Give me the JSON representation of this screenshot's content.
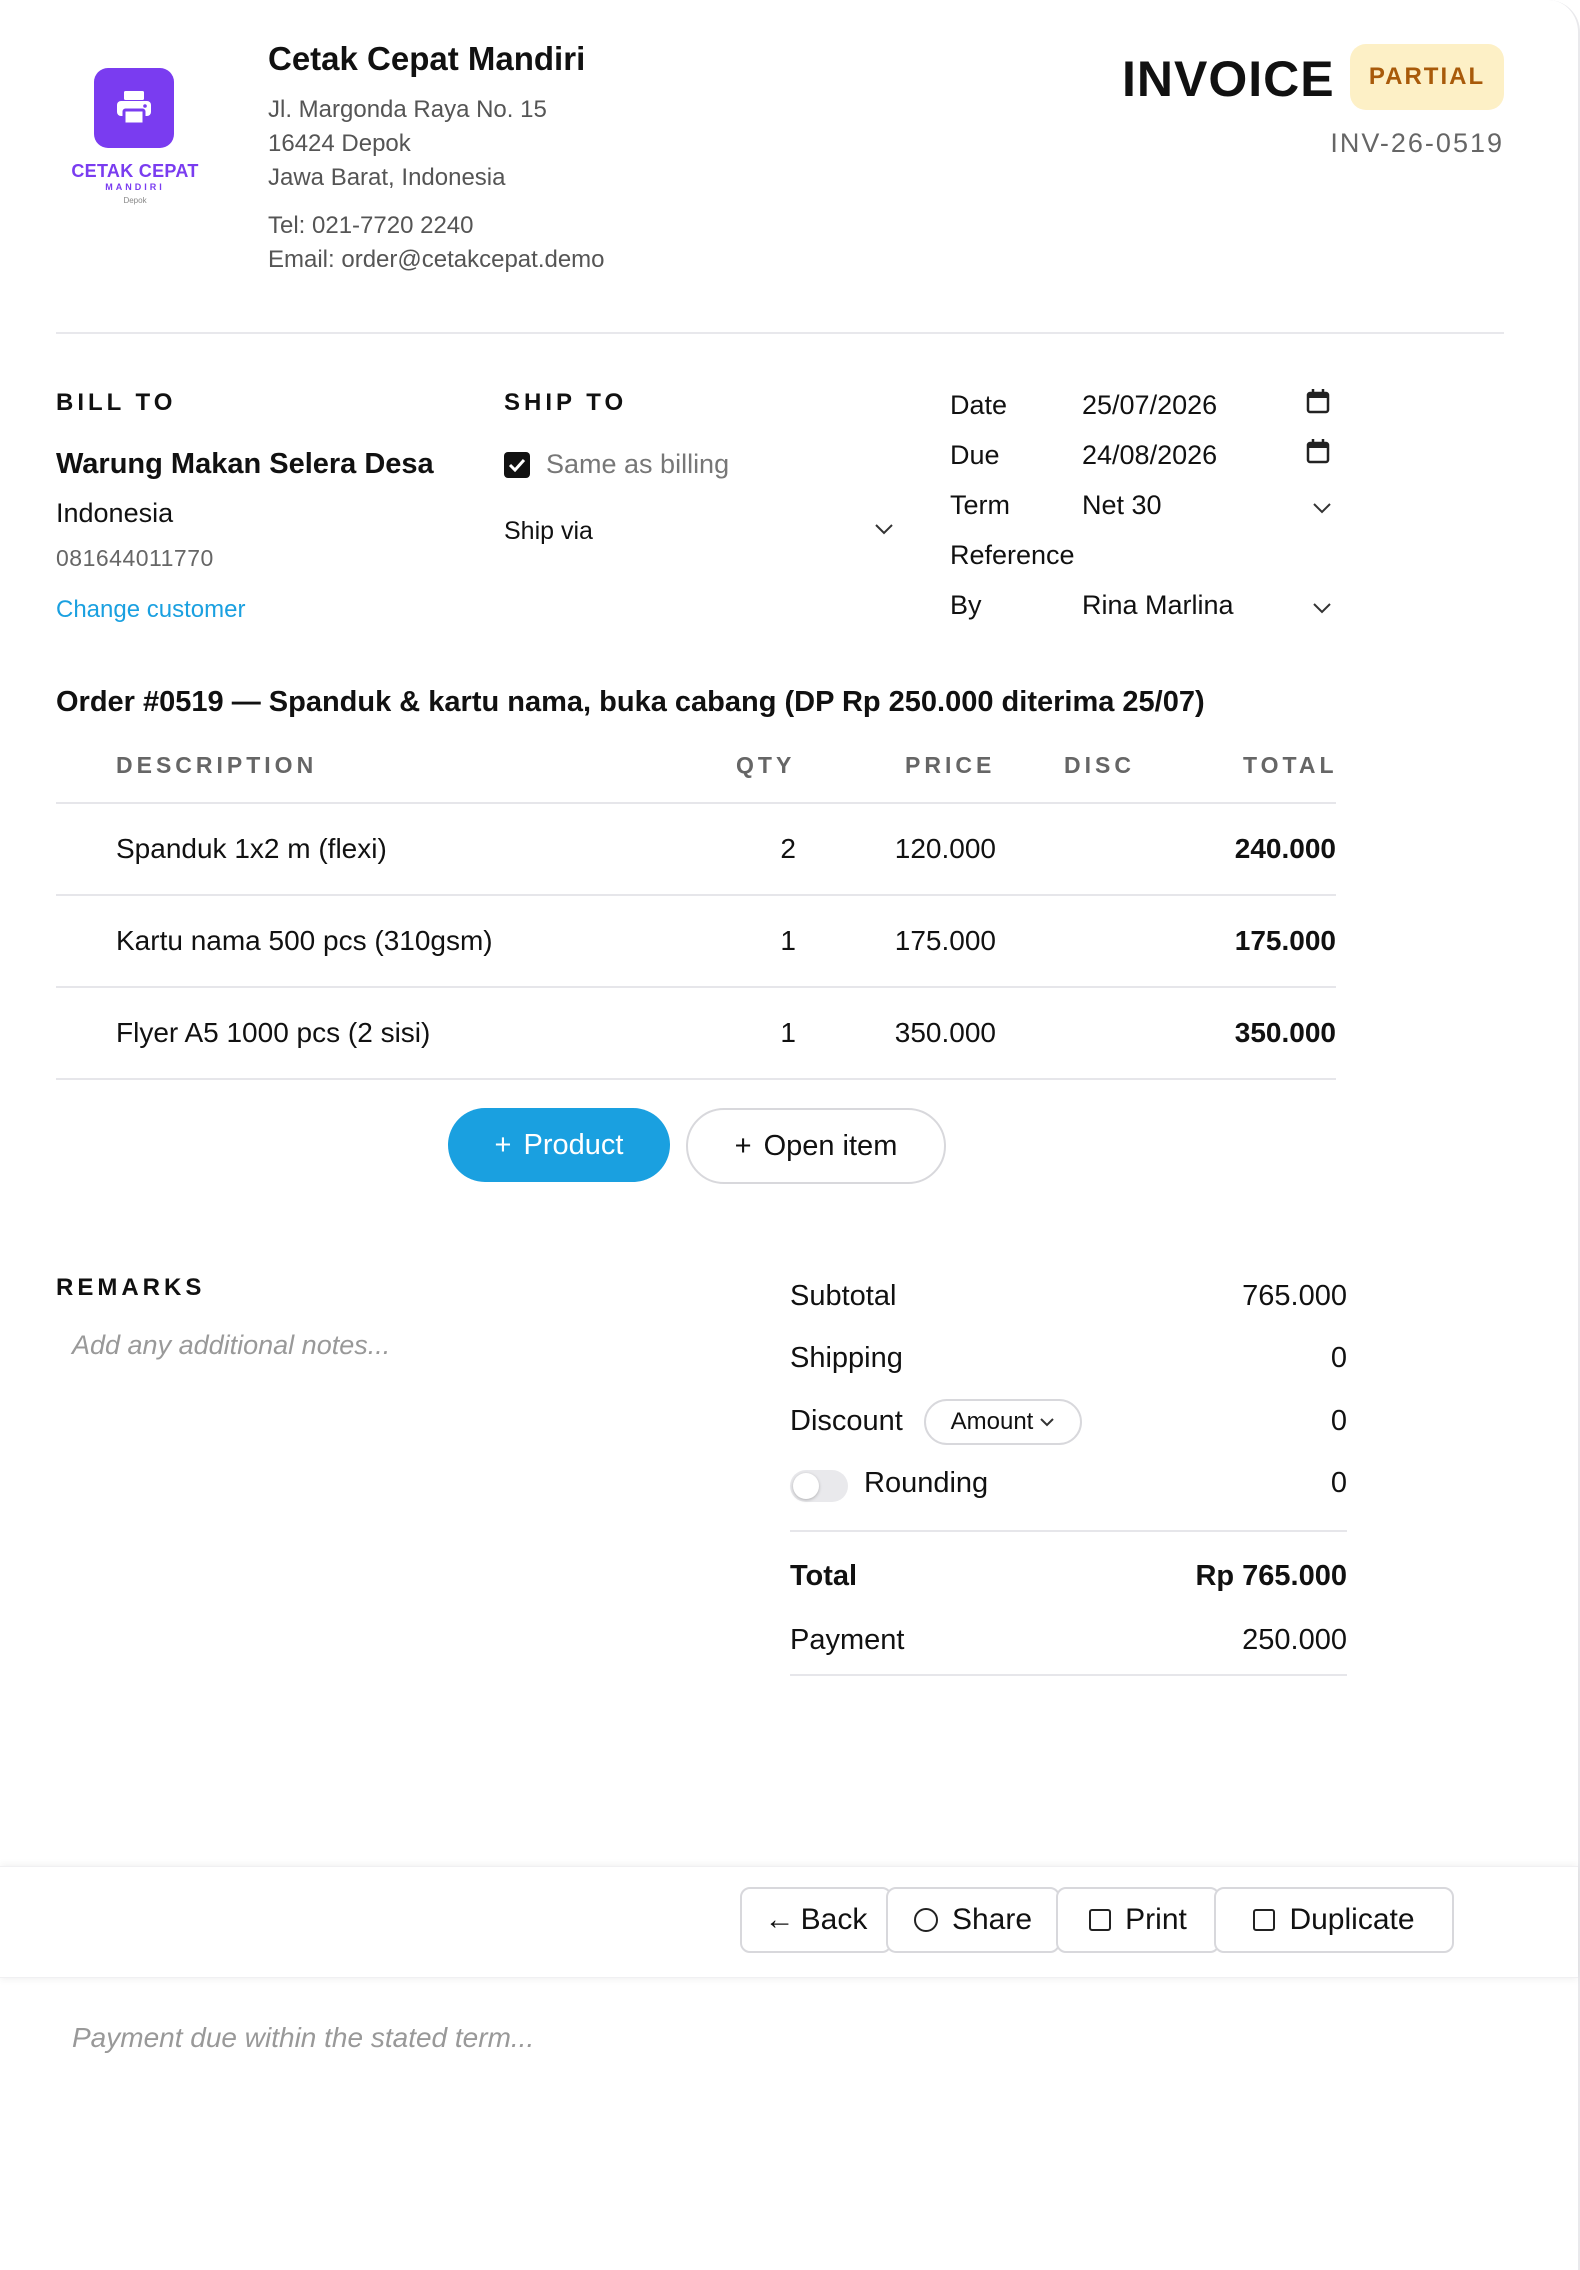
{
  "company": {
    "logo_name": "CETAK CEPAT",
    "logo_sub": "MANDIRI",
    "logo_city": "Depok",
    "name": "Cetak Cepat Mandiri",
    "address1": "Jl. Margonda Raya No. 15",
    "address2": "16424 Depok",
    "address3": "Jawa Barat, Indonesia",
    "tel": "Tel: 021-7720 2240",
    "email": "Email: order@cetakcepat.demo"
  },
  "invoice": {
    "title": "INVOICE",
    "status": "PARTIAL",
    "number": "INV-26-0519"
  },
  "bill_to": {
    "heading": "BILL TO",
    "name": "Warung Makan Selera Desa",
    "country": "Indonesia",
    "phone": "081644011770",
    "change_link": "Change customer"
  },
  "ship_to": {
    "heading": "SHIP TO",
    "same_as_billing_label": "Same as billing",
    "same_as_billing_checked": true,
    "ship_via_placeholder": "Ship via"
  },
  "meta": {
    "date_label": "Date",
    "date_value": "25/07/2026",
    "due_label": "Due",
    "due_value": "24/08/2026",
    "term_label": "Term",
    "term_value": "Net 30",
    "reference_label": "Reference",
    "reference_value": "",
    "by_label": "By",
    "by_value": "Rina Marlina"
  },
  "order_title": "Order #0519 — Spanduk & kartu nama, buka cabang (DP Rp 250.000 diterima 25/07)",
  "table": {
    "headers": {
      "description": "DESCRIPTION",
      "qty": "QTY",
      "price": "PRICE",
      "disc": "DISC",
      "total": "TOTAL"
    },
    "rows": [
      {
        "description": "Spanduk 1x2 m (flexi)",
        "qty": "2",
        "price": "120.000",
        "disc": "",
        "total": "240.000"
      },
      {
        "description": "Kartu nama 500 pcs (310gsm)",
        "qty": "1",
        "price": "175.000",
        "disc": "",
        "total": "175.000"
      },
      {
        "description": "Flyer A5 1000 pcs (2 sisi)",
        "qty": "1",
        "price": "350.000",
        "disc": "",
        "total": "350.000"
      }
    ]
  },
  "actions": {
    "add_product": "Product",
    "add_open_item": "Open item",
    "plus": "+"
  },
  "remarks": {
    "heading": "REMARKS",
    "placeholder": "Add any additional notes..."
  },
  "summary": {
    "subtotal_label": "Subtotal",
    "subtotal_value": "765.000",
    "shipping_label": "Shipping",
    "shipping_value": "0",
    "discount_label": "Discount",
    "discount_type": "Amount",
    "discount_value": "0",
    "rounding_label": "Rounding",
    "rounding_on": false,
    "rounding_value": "0",
    "total_label": "Total",
    "total_value": "Rp 765.000",
    "payment_label": "Payment",
    "payment_value": "250.000"
  },
  "footer": {
    "back": "Back",
    "back_arrow": "←",
    "share": "Share",
    "print": "Print",
    "duplicate": "Duplicate",
    "terms_placeholder": "Payment due within the stated term..."
  },
  "colors": {
    "brand": "#7a3cf0",
    "accent": "#1aa0e0",
    "badge_bg": "#fdf0c6",
    "badge_text": "#a85a0a"
  }
}
